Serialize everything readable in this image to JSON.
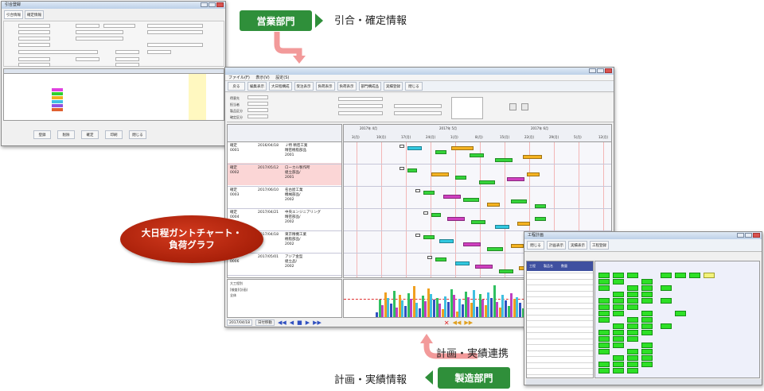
{
  "labels": {
    "sales_dept": "営業部門",
    "sales_info": "引合・確定情報",
    "gantt_oval_line1": "大日程ガントチャート・",
    "gantt_oval_line2": "負荷グラフ",
    "link_label": "計画・実績連携",
    "manufacturing_dept": "製造部門",
    "plan_info": "計画・実績情報"
  },
  "colors": {
    "badge_green": "#2f8f3a",
    "oval_red": "#b7280e",
    "arrow_pink": "#f29a9a",
    "gantt_bar_green": "#35d43a",
    "gantt_bar_magenta": "#d040c0",
    "gantt_bar_orange": "#f5b321",
    "gantt_bar_cyan": "#32c8e0",
    "flow_block_green": "#2ee026"
  },
  "gantt_window": {
    "menu": [
      "ファイル(F)",
      "表示(V)",
      "設定(S)"
    ],
    "toolbar": [
      "戻る",
      "編集表示",
      "大日程構成",
      "受注表示",
      "負荷表示",
      "負荷表示",
      "部門構成品",
      "実績登録",
      "閉じる"
    ],
    "filters": [
      "得意先",
      "担当者",
      "製品区分",
      "確定区分"
    ],
    "dates": [
      "2017年 4月",
      "2017年 5月",
      "2017年 6月"
    ],
    "day_headers": [
      "3(月)",
      "10(月)",
      "17(月)",
      "24(月)",
      "1(月)",
      "8(月)",
      "15(月)",
      "22(月)",
      "29(月)",
      "5(月)",
      "12(月)"
    ],
    "orders": [
      {
        "id": "確定\n0001",
        "date": "2016/04/18",
        "text": "Ｊ特 精密工業\n精密樹脂部品\n2001"
      },
      {
        "id": "確定\n0002",
        "date": "2017/05/12",
        "text": "ローカル製作所\n組立部品/\n2001"
      },
      {
        "id": "確定\n0003",
        "date": "2017/06/10",
        "text": "名古屋工業\n機械部品/\n2002"
      },
      {
        "id": "確定\n0004",
        "date": "2017/04/21",
        "text": "中央エンジニアリング\n精密部品/\n2002"
      },
      {
        "id": "確定\n0005",
        "date": "2017/04/18",
        "text": "東京精機工業\n樹脂部品/\n2002"
      },
      {
        "id": "確定\n0006",
        "date": "2017/05/01",
        "text": "アジア金型\n組立品/\n2002"
      }
    ],
    "load_panel": [
      "大工程別",
      "[検査](計画)",
      "全体"
    ],
    "footer": [
      "2017/04/18",
      "日付移動"
    ]
  },
  "order_window": {
    "title": "引合登録",
    "tabs": [
      "引合情報",
      "確定情報"
    ],
    "buttons": [
      "登録",
      "削除",
      "閉じる",
      "確定",
      "印刷"
    ]
  },
  "mfg_window": {
    "title": "工程計画",
    "toolbar": [
      "閉じる",
      "計画表示",
      "実績表示",
      "工程登録"
    ],
    "columns": [
      "工程",
      "製品名",
      "数量"
    ]
  }
}
